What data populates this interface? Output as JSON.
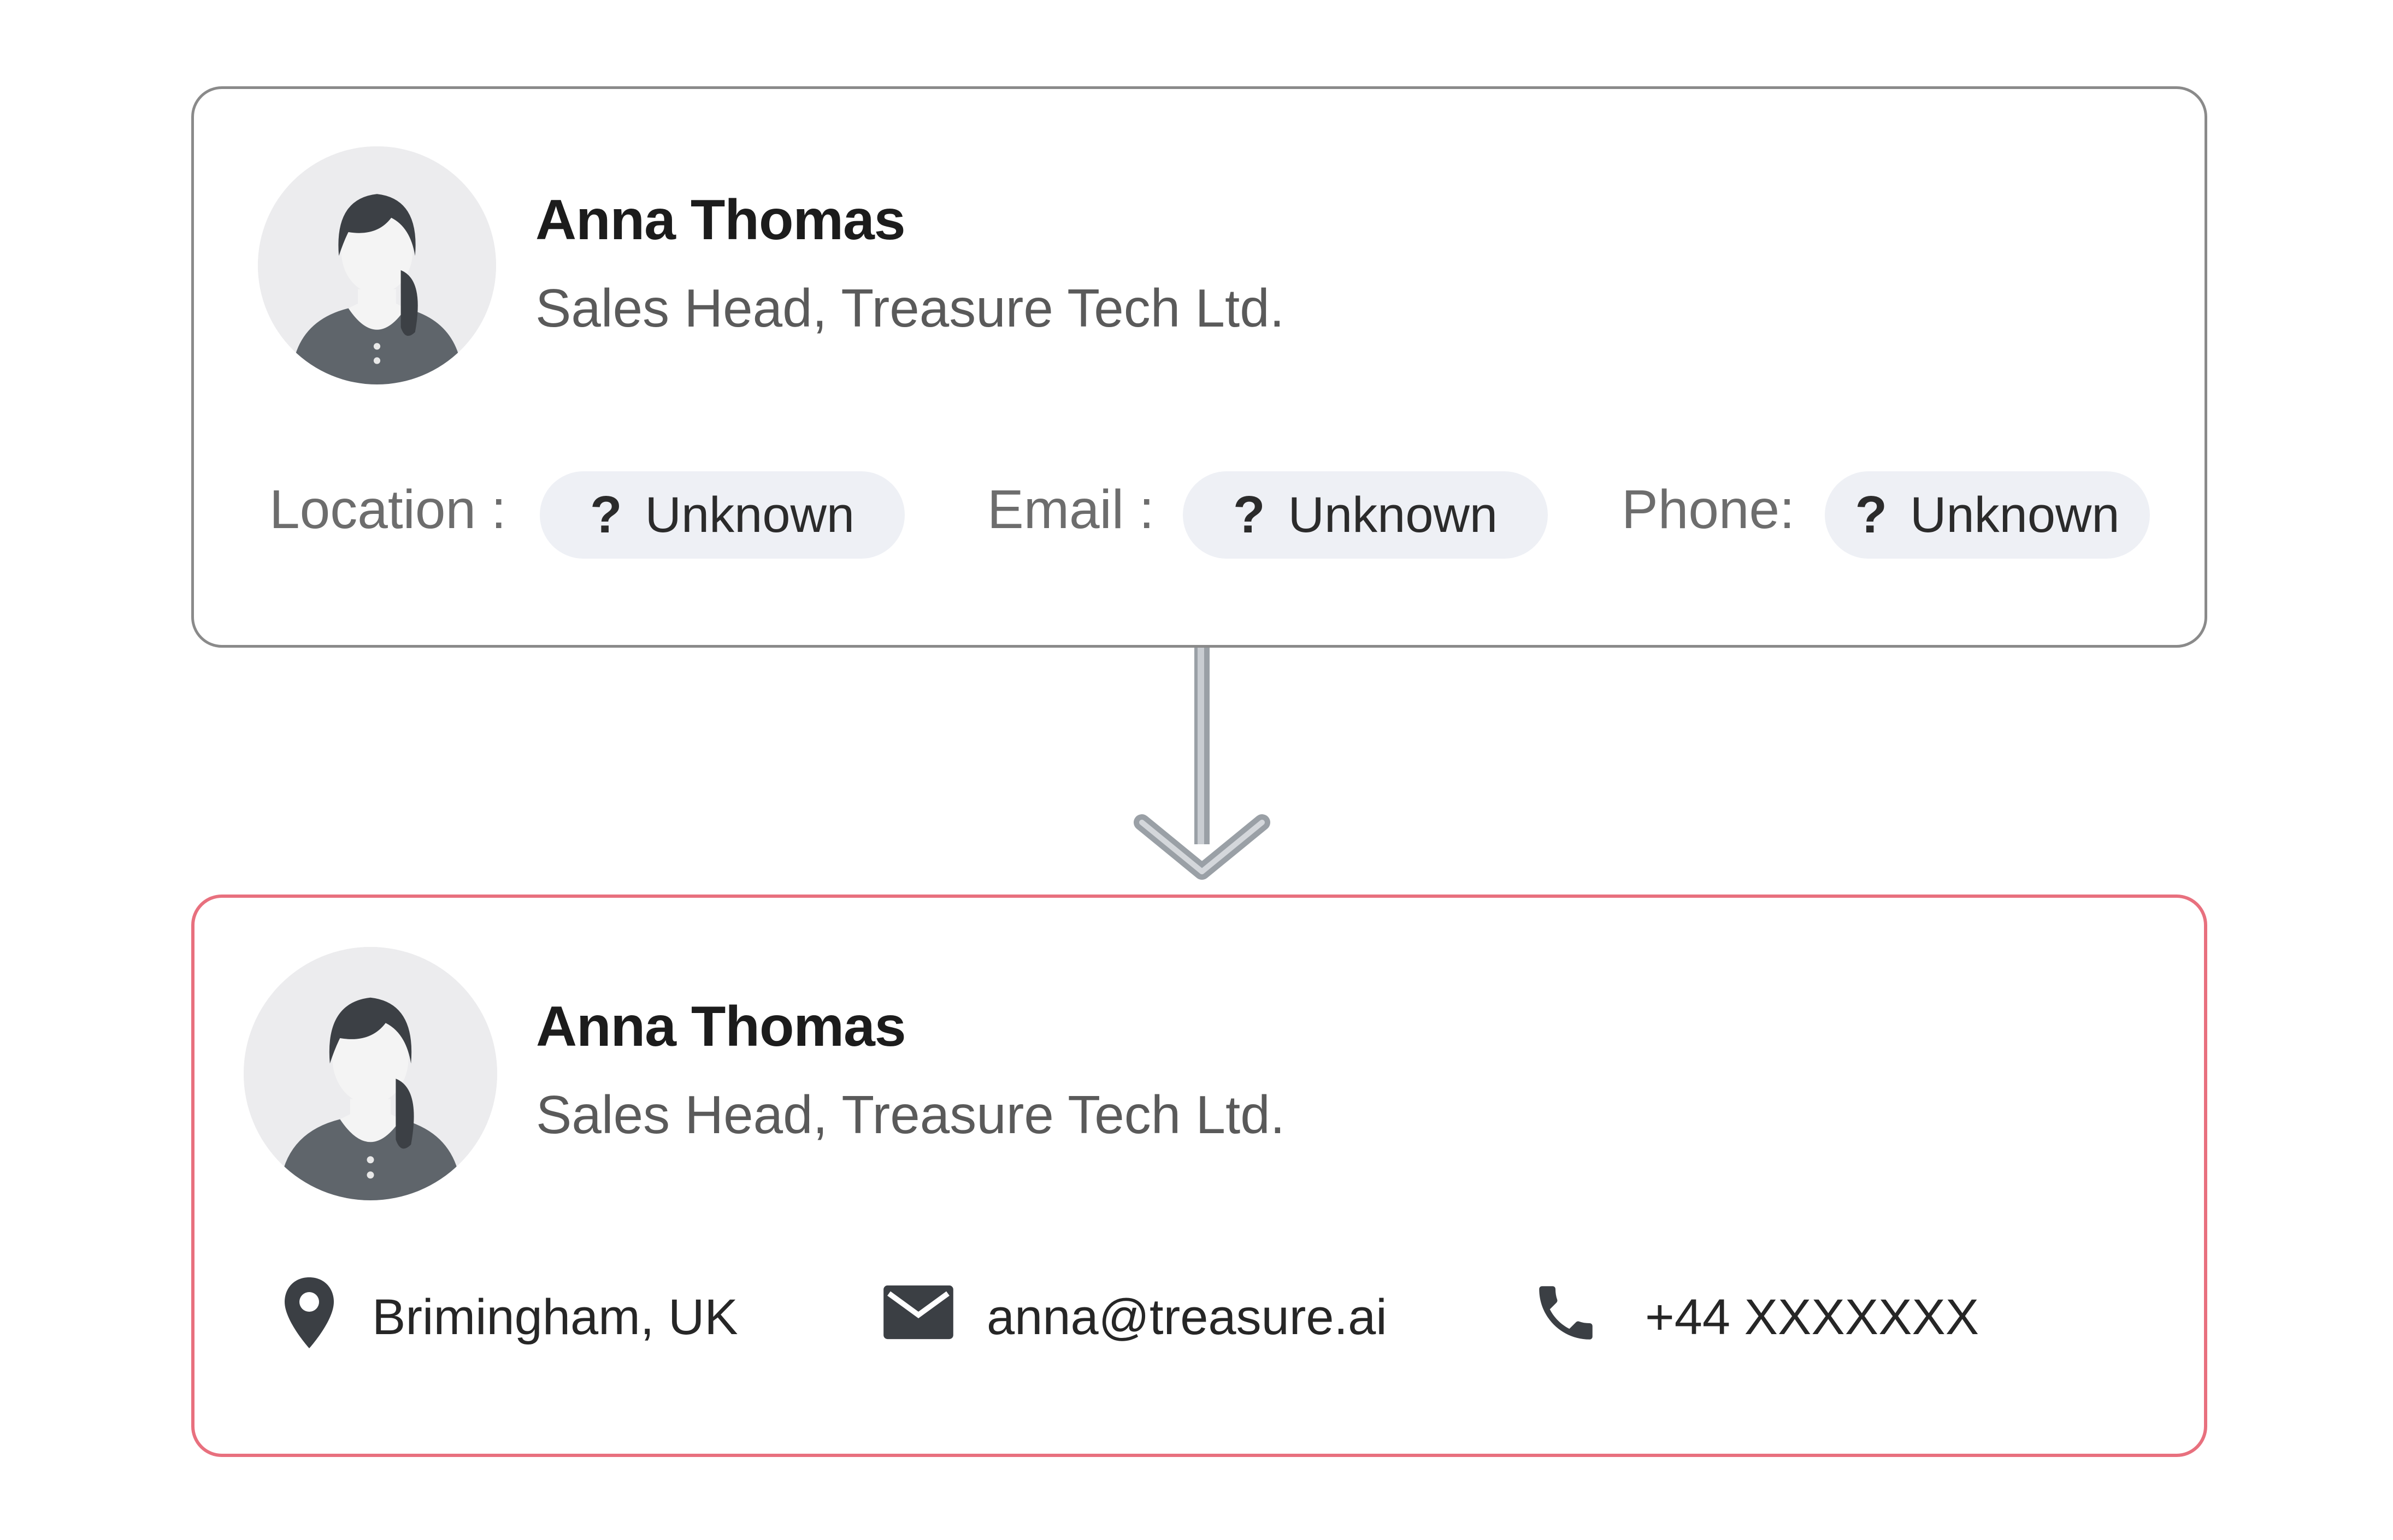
{
  "before_card": {
    "name": "Anna Thomas",
    "title": "Sales Head, Treasure Tech Ltd.",
    "fields": [
      {
        "label": "Location :",
        "value": "Unknown",
        "icon": "question-mark"
      },
      {
        "label": "Email :",
        "value": "Unknown",
        "icon": "question-mark"
      },
      {
        "label": "Phone:",
        "value": "Unknown",
        "icon": "question-mark"
      }
    ],
    "unknown_glyph": "?",
    "border_color": "#8a8a8a"
  },
  "arrow": {
    "icon": "down-arrow",
    "color": "#9aa0a6"
  },
  "after_card": {
    "name": "Anna Thomas",
    "title": "Sales Head, Treasure Tech Ltd.",
    "contacts": [
      {
        "icon": "location-pin-icon",
        "value": "Brimingham, UK"
      },
      {
        "icon": "mail-icon",
        "value": "anna@treasure.ai"
      },
      {
        "icon": "phone-icon",
        "value": "+44 XXXXXXX"
      }
    ],
    "border_color": "#e8707e"
  }
}
